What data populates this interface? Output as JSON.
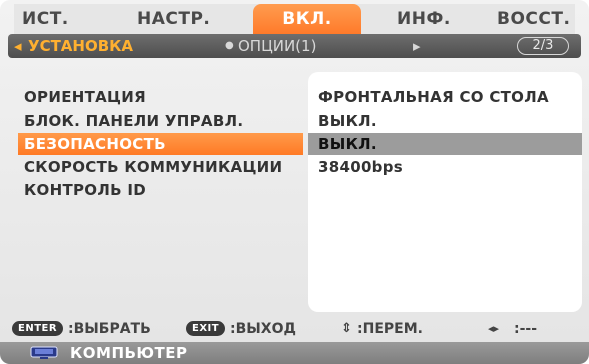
{
  "tabs": [
    {
      "label": "ИСТ."
    },
    {
      "label": "НАСТР."
    },
    {
      "label": "ВКЛ.",
      "active": true
    },
    {
      "label": "ИНФ."
    },
    {
      "label": "ВОССТ."
    }
  ],
  "subtabs": {
    "arrow_left": "◂",
    "current": "УСТАНОВКА",
    "bullet": "●",
    "next": "ОПЦИИ(1)",
    "arrow_right": "▸",
    "page": "2/3"
  },
  "settings": [
    {
      "label": "ОРИЕНТАЦИЯ",
      "value": "ФРОНТАЛЬНАЯ СО СТОЛА"
    },
    {
      "label": "БЛОК. ПАНЕЛИ УПРАВЛ.",
      "value": "ВЫКЛ."
    },
    {
      "label": "БЕЗОПАСНОСТЬ",
      "value": "ВЫКЛ.",
      "selected": true
    },
    {
      "label": "СКОРОСТЬ КОММУНИКАЦИИ",
      "value": "38400bps"
    },
    {
      "label": "КОНТРОЛЬ ID",
      "value": ""
    }
  ],
  "help": {
    "enter_key": "ENTER",
    "enter_text": ":ВЫБРАТЬ",
    "exit_key": "EXIT",
    "exit_text": ":ВЫХОД",
    "move_glyph": "⇕",
    "move_text": ":ПЕРЕМ.",
    "lr_glyph": "◂▸",
    "lr_text": ":---"
  },
  "source": {
    "label": "КОМПЬЮТЕР",
    "icon": "monitor-icon"
  },
  "colors": {
    "accent": "#ff8030",
    "selected_value_bg": "#9c9c9c",
    "subtab_active": "#ffb030"
  }
}
